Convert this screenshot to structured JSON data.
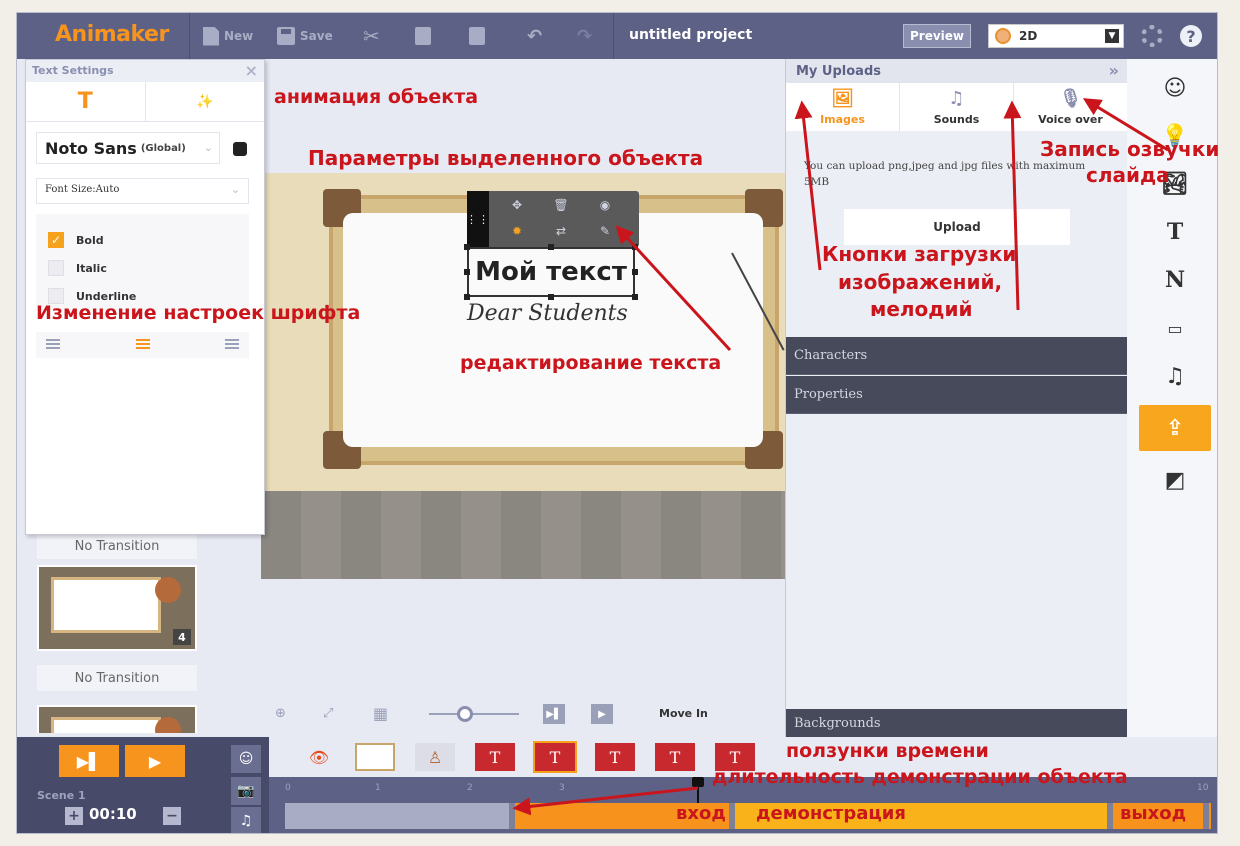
{
  "app": {
    "logo": "Animaker",
    "toolbar": {
      "new_label": "New",
      "save_label": "Save"
    },
    "project_title": "untitled project",
    "preview_label": "Preview",
    "mode_value": "2D"
  },
  "text_settings": {
    "header": "Text Settings",
    "tab_text_icon": "T",
    "font_name": "Noto Sans",
    "font_scope": "(Global)",
    "font_size": "Font Size:Auto",
    "styles": [
      {
        "label": "Bold",
        "checked": true
      },
      {
        "label": "Italic",
        "checked": false
      },
      {
        "label": "Underline",
        "checked": false
      }
    ]
  },
  "slides": {
    "transition_1": "No Transition",
    "slide_number": "4",
    "transition_2": "No Transition"
  },
  "stage": {
    "board_text": "Мой текст",
    "board_script": "Dear Students"
  },
  "canvas_controls": {
    "move_label": "Move In"
  },
  "uploads": {
    "header": "My Uploads",
    "tabs": [
      {
        "label": "Images",
        "icon": "image-icon",
        "active": true
      },
      {
        "label": "Sounds",
        "icon": "music-note-icon",
        "active": false
      },
      {
        "label": "Voice over",
        "icon": "microphone-icon",
        "active": false
      }
    ],
    "info": "You can upload png,jpeg and jpg files with maximum 5MB",
    "upload_label": "Upload",
    "sections": [
      "Characters",
      "Properties",
      "Backgrounds"
    ]
  },
  "rail": {
    "items": [
      "character-icon",
      "bulb-icon",
      "image-icon",
      "text-icon",
      "numbers-icon",
      "effects-icon",
      "music-icon",
      "upload-icon",
      "background-icon"
    ],
    "text_glyph": "T",
    "number_glyph": "N",
    "active": "upload-icon"
  },
  "timeline": {
    "scene_label": "Scene 1",
    "duration": "00:10",
    "ticks": [
      "0",
      "1",
      "2",
      "3",
      "10"
    ],
    "text_glyph": "T"
  },
  "annotations": {
    "animation": "анимация объекта",
    "selected_params": "Параметры выделенного объекта",
    "font_settings": "Изменение настроек шрифта",
    "text_edit": "редактирование текста",
    "voice_line1": "Запись озвучки",
    "voice_line2": "слайда",
    "upload_line1": "Кнопки загрузки",
    "upload_line2": "изображений,",
    "upload_line3": "мелодий",
    "time_sliders": "ползунки времени",
    "duration_label": "длительность демонстрации объекта",
    "enter": "вход",
    "display": "демонстрация",
    "exit": "выход"
  },
  "colors": {
    "accent": "#f7941d",
    "toolbar_bg": "#5d6186",
    "annotation_red": "#c9151b"
  }
}
